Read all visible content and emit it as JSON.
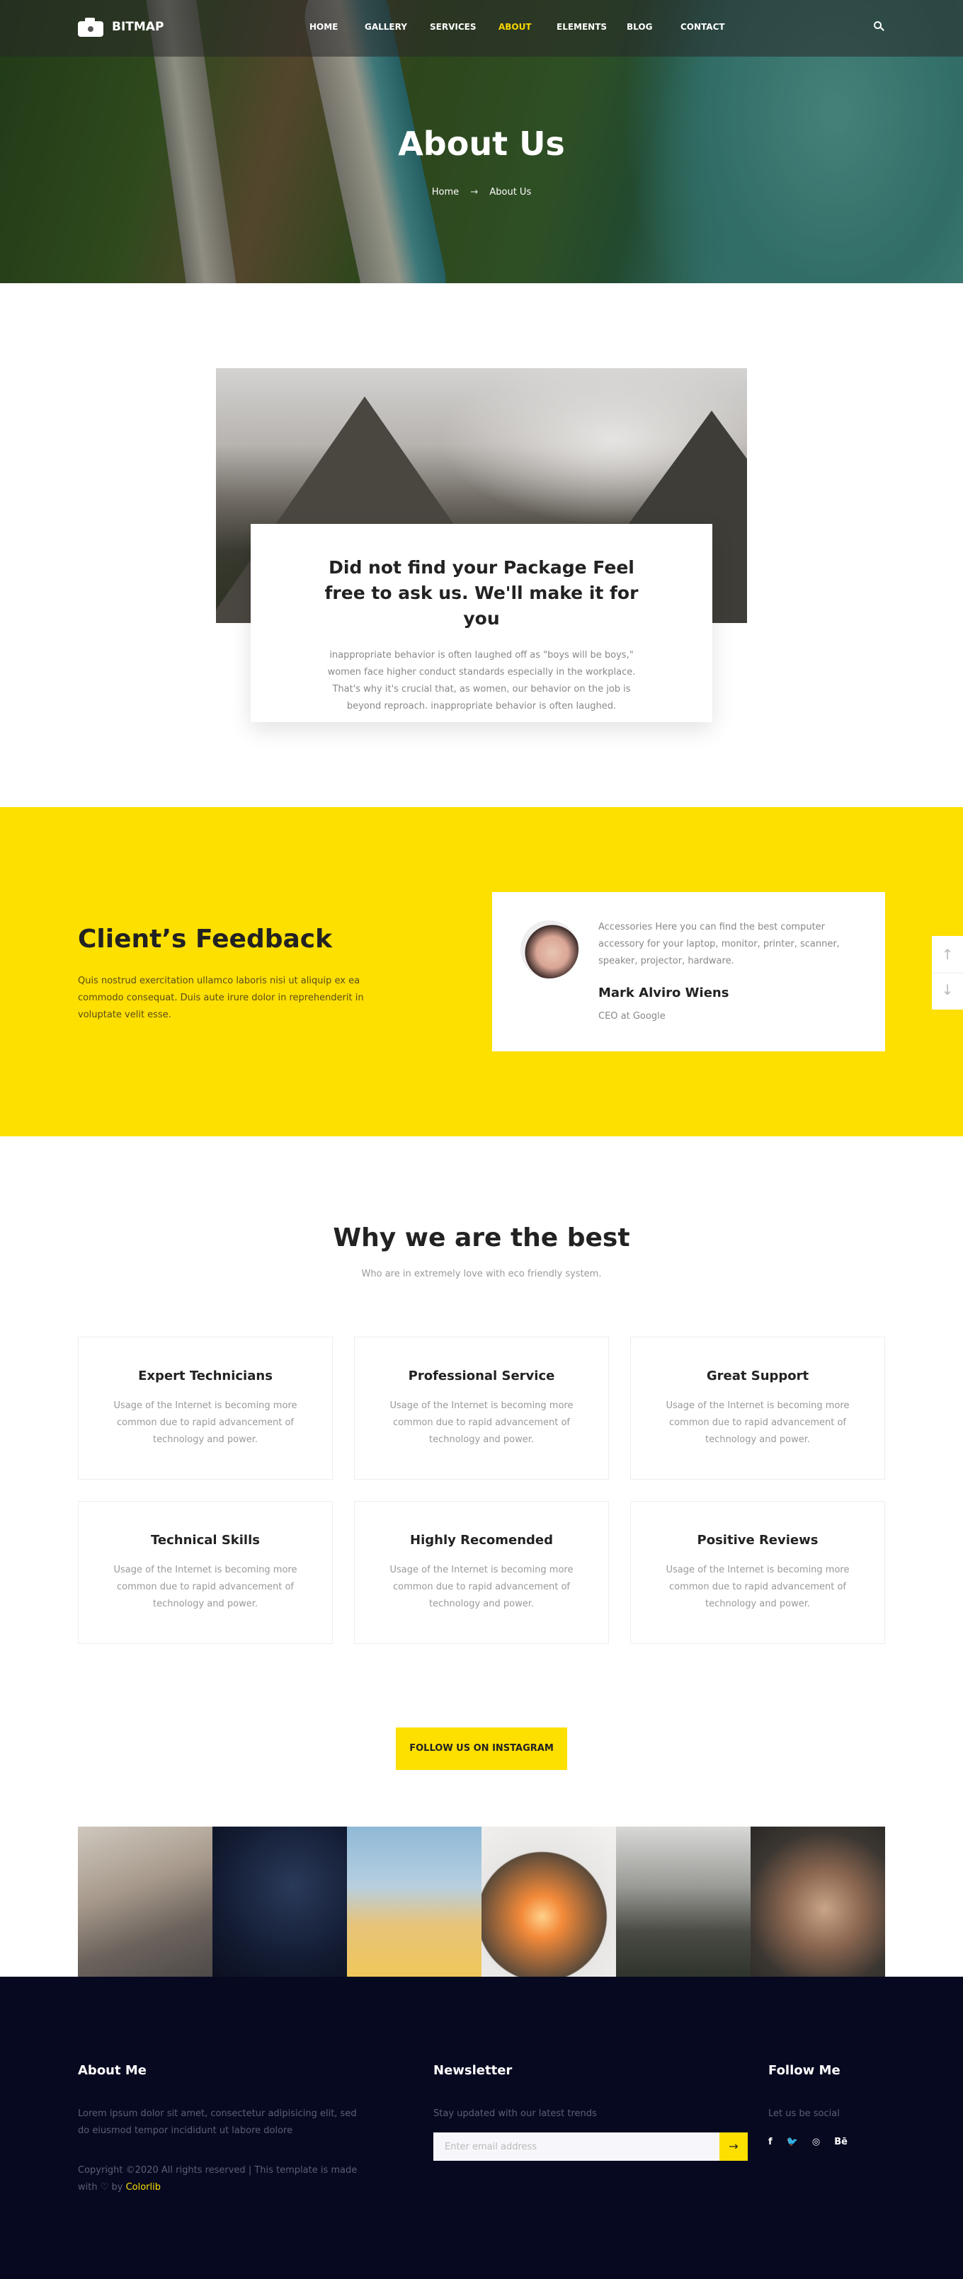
{
  "brand": {
    "name": "BITMAP"
  },
  "nav": {
    "items": [
      {
        "label": "HOME"
      },
      {
        "label": "GALLERY"
      },
      {
        "label": "SERVICES"
      },
      {
        "label": "ABOUT"
      },
      {
        "label": "ELEMENTS"
      },
      {
        "label": "BLOG"
      },
      {
        "label": "CONTACT"
      }
    ],
    "active": "ABOUT"
  },
  "hero": {
    "title": "About Us",
    "breadcrumb": {
      "home": "Home",
      "separator": "→",
      "current": "About Us"
    }
  },
  "package": {
    "title": "Did not find your Package Feel free to ask us. We'll make it for you",
    "text": "inappropriate behavior is often laughed off as \"boys will be boys,\" women face higher conduct standards especially in the workplace. That's why it's crucial that, as women, our behavior on the job is beyond reproach. inappropriate behavior is often laughed."
  },
  "feedback": {
    "title": "Client’s Feedback",
    "text": "Quis nostrud exercitation ullamco laboris nisi ut aliquip ex ea commodo consequat. Duis aute irure dolor in reprehenderit in voluptate velit esse.",
    "quote": "Accessories Here you can find the best computer accessory for your laptop, monitor, printer, scanner, speaker, projector, hardware.",
    "name": "Mark Alviro Wiens",
    "role": "CEO at Google",
    "arrow_up": "↑",
    "arrow_down": "↓"
  },
  "why": {
    "title": "Why we are the best",
    "subtitle": "Who are in extremely love with eco friendly system.",
    "features": [
      {
        "title": "Expert Technicians",
        "text": "Usage of the Internet is becoming more common due to rapid advancement of technology and power."
      },
      {
        "title": "Professional Service",
        "text": "Usage of the Internet is becoming more common due to rapid advancement of technology and power."
      },
      {
        "title": "Great Support",
        "text": "Usage of the Internet is becoming more common due to rapid advancement of technology and power."
      },
      {
        "title": "Technical Skills",
        "text": "Usage of the Internet is becoming more common due to rapid advancement of technology and power."
      },
      {
        "title": "Highly Recomended",
        "text": "Usage of the Internet is becoming more common due to rapid advancement of technology and power."
      },
      {
        "title": "Positive Reviews",
        "text": "Usage of the Internet is becoming more common due to rapid advancement of technology and power."
      }
    ]
  },
  "instagram": {
    "button_label": "FOLLOW US ON INSTAGRAM"
  },
  "footer": {
    "about": {
      "title": "About Me",
      "text": "Lorem ipsum dolor sit amet, consectetur adipisicing elit, sed do eiusmod tempor incididunt ut labore dolore",
      "copyright_prefix": "Copyright ©2020 All rights reserved | This template is made with ♡ by ",
      "copyright_brand": "Colorlib"
    },
    "newsletter": {
      "title": "Newsletter",
      "text": "Stay updated with our latest trends",
      "placeholder": "Enter email address",
      "submit_icon": "→"
    },
    "follow": {
      "title": "Follow Me",
      "text": "Let us be social",
      "icons": [
        "f",
        "🐦",
        "◎",
        "Bē"
      ]
    }
  },
  "colors": {
    "accent": "#fddf00",
    "footer_bg": "#070920"
  }
}
